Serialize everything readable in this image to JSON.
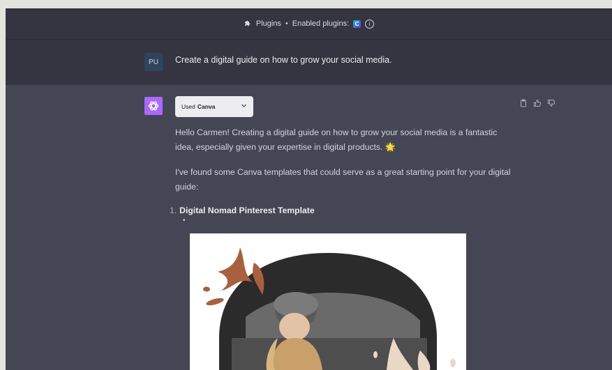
{
  "header": {
    "plugins_label": "Plugins",
    "separator": "•",
    "enabled_label": "Enabled plugins:",
    "canva_badge": "C"
  },
  "conversation": {
    "user": {
      "avatar_initials": "PU",
      "message": "Create a digital guide on how to grow your social media."
    },
    "assistant": {
      "tool_used_prefix": "Used",
      "tool_used_name": "Canva",
      "paragraph1": "Hello Carmen! Creating a digital guide on how to grow your social media is a fantastic idea, especially given your expertise in digital products. 🌟",
      "paragraph2": "I've found some Canva templates that could serve as a great starting point for your digital guide:",
      "list": [
        {
          "number": "1.",
          "title": "Digital Nomad Pinterest Template"
        }
      ],
      "bullet": "•"
    }
  },
  "colors": {
    "app_bg": "#343541",
    "assistant_bg": "#444654",
    "gpt_avatar": "#ab68ff",
    "user_avatar": "#30455b"
  },
  "icons": [
    "puzzle-icon",
    "canva-icon",
    "info-icon",
    "openai-logo-icon",
    "chevron-down-icon",
    "clipboard-icon",
    "thumbs-up-icon",
    "thumbs-down-icon"
  ]
}
